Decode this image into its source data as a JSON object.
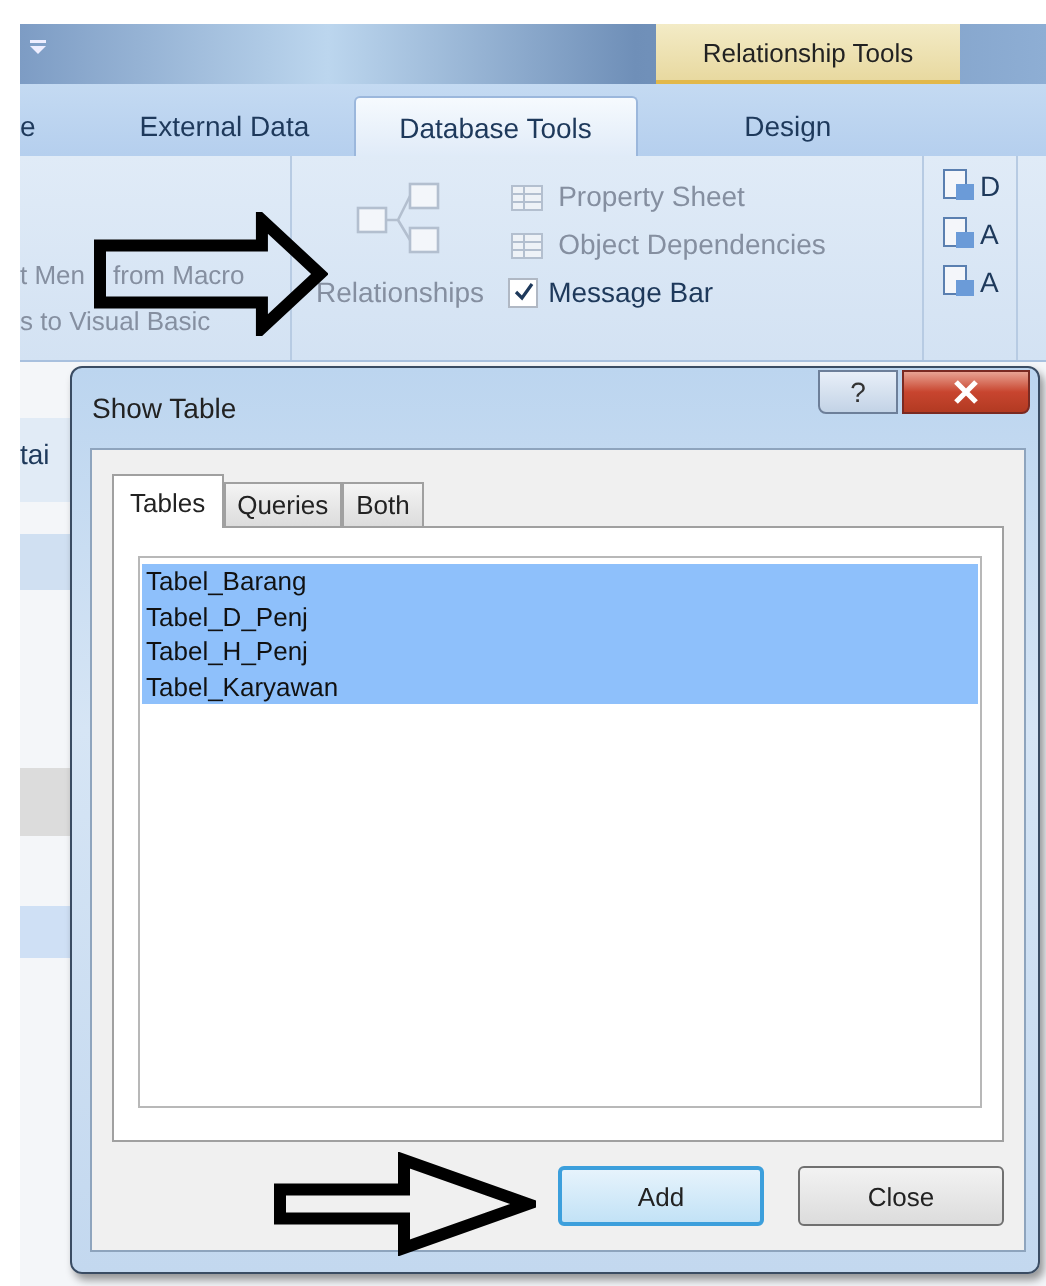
{
  "ribbon": {
    "contextual_tab": "Relationship Tools",
    "tabs": [
      {
        "label": "e",
        "selected": false
      },
      {
        "label": "External Data",
        "selected": false
      },
      {
        "label": "Database Tools",
        "selected": true
      },
      {
        "label": "Design",
        "selected": false
      }
    ],
    "macro_group": {
      "disabled": true,
      "lines": [
        [
          "t Men",
          "from Macro"
        ],
        [
          "s to Visual Basic"
        ]
      ]
    },
    "show_hide_group": {
      "large_button": {
        "label": "Relationships",
        "disabled": true
      },
      "items": [
        {
          "kind": "button",
          "label": "Property Sheet",
          "disabled": true
        },
        {
          "kind": "button",
          "label": "Object Dependencies",
          "disabled": true
        },
        {
          "kind": "checkbox",
          "label": "Message Bar",
          "checked": true,
          "disabled": false
        }
      ]
    },
    "right_group": {
      "items": [
        {
          "label": "D"
        },
        {
          "label": "A"
        },
        {
          "label": "A"
        }
      ]
    }
  },
  "background": {
    "nav_label": "tai"
  },
  "dialog": {
    "title": "Show Table",
    "help_button": "?",
    "tabs": [
      {
        "label": "Tables",
        "selected": true
      },
      {
        "label": "Queries",
        "selected": false
      },
      {
        "label": "Both",
        "selected": false
      }
    ],
    "list_items": [
      {
        "label": "Tabel_Barang",
        "selected": true
      },
      {
        "label": "Tabel_D_Penj",
        "selected": true
      },
      {
        "label": "Tabel_H_Penj",
        "selected": true
      },
      {
        "label": "Tabel_Karyawan",
        "selected": true
      }
    ],
    "buttons": [
      {
        "label": "Add",
        "default": true
      },
      {
        "label": "Close",
        "default": false
      }
    ]
  }
}
